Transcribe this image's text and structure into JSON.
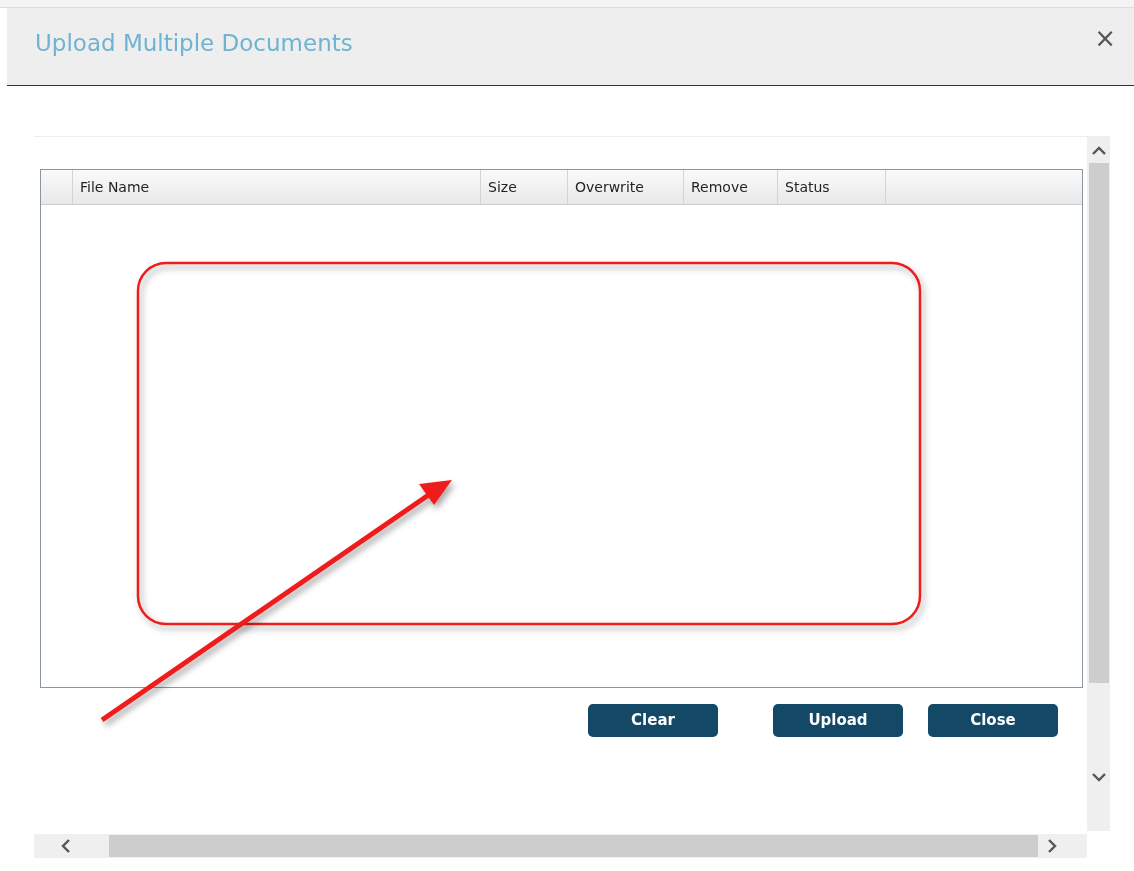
{
  "dialog": {
    "title": "Upload Multiple Documents",
    "close_symbol": "×"
  },
  "table": {
    "columns": [
      {},
      {
        "label": "File Name"
      },
      {
        "label": "Size"
      },
      {
        "label": "Overwrite"
      },
      {
        "label": "Remove"
      },
      {
        "label": "Status"
      }
    ]
  },
  "buttons": [
    {
      "label": "Clear"
    },
    {
      "label": "Upload"
    },
    {
      "label": "Close"
    }
  ]
}
